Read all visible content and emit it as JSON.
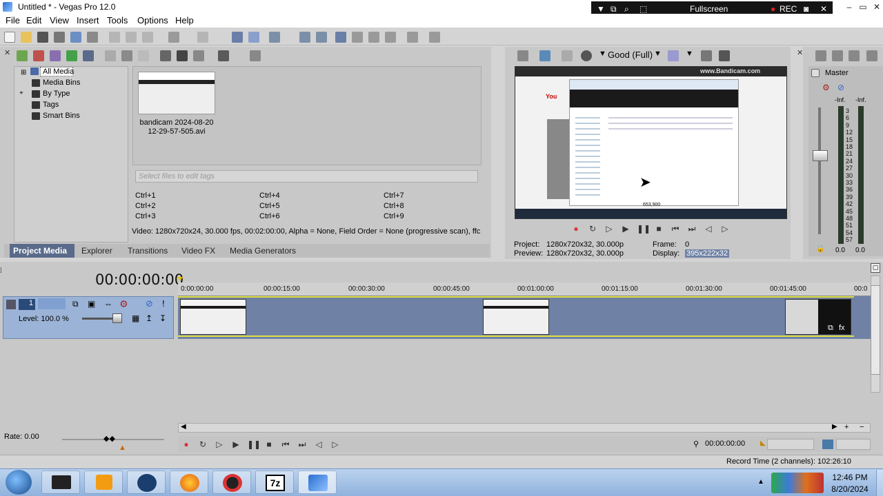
{
  "window": {
    "title": "Untitled * - Vegas Pro 12.0"
  },
  "bandicam": {
    "mode": "Fullscreen",
    "rec": "REC"
  },
  "menu": [
    "File",
    "Edit",
    "View",
    "Insert",
    "Tools",
    "Options",
    "Help"
  ],
  "media_tree": [
    "All Media",
    "Media Bins",
    "By Type",
    "Tags",
    "Smart Bins"
  ],
  "media_file": {
    "name_line1": "bandicam 2024-08-20",
    "name_line2": "12-29-57-505.avi"
  },
  "tags": {
    "placeholder": "Select files to edit tags",
    "shortcuts": [
      "Ctrl+1",
      "Ctrl+4",
      "Ctrl+7",
      "Ctrl+2",
      "Ctrl+5",
      "Ctrl+8",
      "Ctrl+3",
      "Ctrl+6",
      "Ctrl+9"
    ]
  },
  "media_info": "Video: 1280x720x24, 30.000 fps, 00:02:00:00, Alpha = None, Field Order = None (progressive scan), ffc",
  "tabs": [
    "Project Media",
    "Explorer",
    "Transitions",
    "Video FX",
    "Media Generators"
  ],
  "preview": {
    "quality": "Good (Full)",
    "project_label": "Project:",
    "project_value": "1280x720x32, 30.000p",
    "preview_label": "Preview:",
    "preview_value": "1280x720x32, 30.000p",
    "frame_label": "Frame:",
    "frame_value": "0",
    "display_label": "Display:",
    "display_value": "395x222x32",
    "screen_url": "www.Bandicam.com",
    "screen_size": "653,900"
  },
  "master": {
    "label": "Master",
    "left_peak": "-Inf.",
    "right_peak": "-Inf.",
    "scale": [
      "3",
      "6",
      "9",
      "12",
      "15",
      "18",
      "21",
      "24",
      "27",
      "30",
      "33",
      "36",
      "39",
      "42",
      "45",
      "48",
      "51",
      "54",
      "57"
    ],
    "bottom_left": "0.0",
    "bottom_right": "0.0"
  },
  "timeline": {
    "timecode": "00:00:00:00",
    "ruler": [
      "0:00:00:00",
      "00:00:15:00",
      "00:00:30:00",
      "00:00:45:00",
      "00:01:00:00",
      "00:01:15:00",
      "00:01:30:00",
      "00:01:45:00",
      "00:0"
    ],
    "track_number": "1",
    "level": "Level: 100.0 %",
    "rate": "Rate: 0.00",
    "position": "00:00:00:00"
  },
  "status": {
    "record_time": "Record Time (2 channels): 102:26:10"
  },
  "taskbar": {
    "time": "12:46 PM",
    "date": "8/20/2024",
    "seven_zip": "7z"
  }
}
